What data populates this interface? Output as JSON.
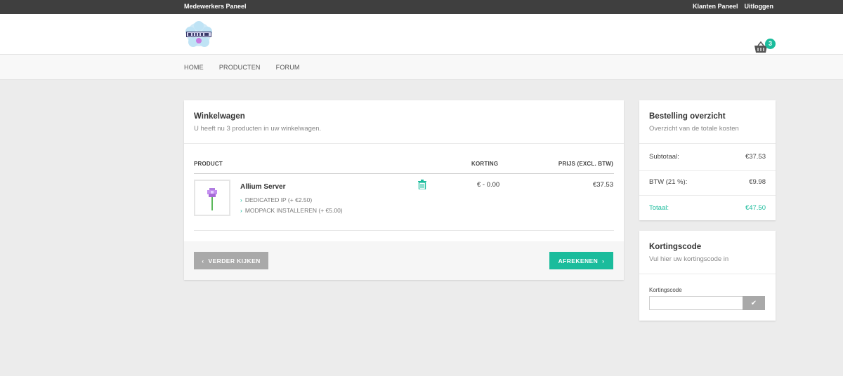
{
  "topbar": {
    "staff_panel": "Medewerkers Paneel",
    "client_panel": "Klanten Paneel",
    "logout": "Uitloggen"
  },
  "header": {
    "logo_alt": "ALLIUM",
    "cart_count": "3",
    "cart_icon": "basket-icon"
  },
  "nav": {
    "items": [
      {
        "label": "HOME"
      },
      {
        "label": "PRODUCTEN"
      },
      {
        "label": "FORUM"
      }
    ]
  },
  "cart": {
    "title": "Winkelwagen",
    "subtitle": "U heeft nu 3 producten in uw winkelwagen.",
    "columns": {
      "product": "PRODUCT",
      "discount": "KORTING",
      "price": "PRIJS (EXCL. BTW)"
    },
    "items": [
      {
        "name": "Allium Server",
        "options": [
          "DEDICATED IP (+ €2.50)",
          "MODPACK INSTALLEREN (+ €5.00)"
        ],
        "discount": "€ - 0.00",
        "price": "€37.53"
      }
    ],
    "back_button": "VERDER KIJKEN",
    "checkout_button": "AFREKENEN"
  },
  "summary": {
    "title": "Bestelling overzicht",
    "subtitle": "Overzicht van de totale kosten",
    "subtotal_label": "Subtotaal:",
    "subtotal_value": "€37.53",
    "vat_label": "BTW (21 %):",
    "vat_value": "€9.98",
    "total_label": "Totaal:",
    "total_value": "€47.50"
  },
  "coupon": {
    "title": "Kortingscode",
    "subtitle": "Vul hier uw kortingscode in",
    "field_label": "Kortingscode",
    "field_value": "",
    "submit_icon": "check-icon"
  },
  "colors": {
    "accent": "#1abc9c",
    "topbar": "#3f3f3f",
    "grey_button": "#a9a9a9"
  }
}
